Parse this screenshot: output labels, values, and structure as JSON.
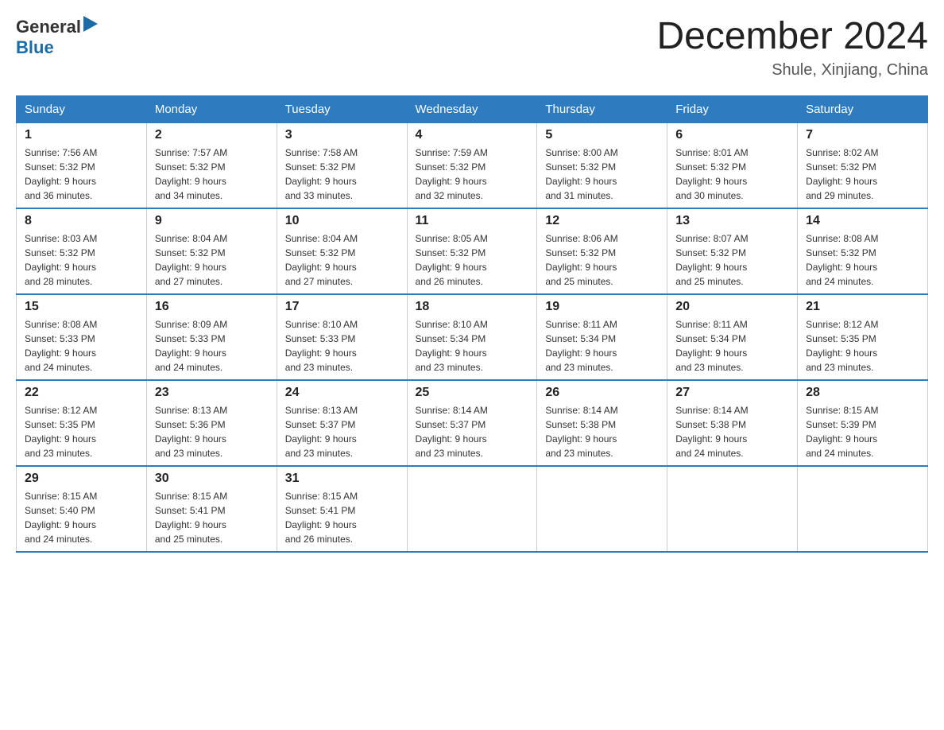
{
  "logo": {
    "general": "General",
    "blue": "Blue"
  },
  "title": "December 2024",
  "location": "Shule, Xinjiang, China",
  "weekdays": [
    "Sunday",
    "Monday",
    "Tuesday",
    "Wednesday",
    "Thursday",
    "Friday",
    "Saturday"
  ],
  "weeks": [
    [
      {
        "day": "1",
        "sunrise": "7:56 AM",
        "sunset": "5:32 PM",
        "daylight": "9 hours and 36 minutes."
      },
      {
        "day": "2",
        "sunrise": "7:57 AM",
        "sunset": "5:32 PM",
        "daylight": "9 hours and 34 minutes."
      },
      {
        "day": "3",
        "sunrise": "7:58 AM",
        "sunset": "5:32 PM",
        "daylight": "9 hours and 33 minutes."
      },
      {
        "day": "4",
        "sunrise": "7:59 AM",
        "sunset": "5:32 PM",
        "daylight": "9 hours and 32 minutes."
      },
      {
        "day": "5",
        "sunrise": "8:00 AM",
        "sunset": "5:32 PM",
        "daylight": "9 hours and 31 minutes."
      },
      {
        "day": "6",
        "sunrise": "8:01 AM",
        "sunset": "5:32 PM",
        "daylight": "9 hours and 30 minutes."
      },
      {
        "day": "7",
        "sunrise": "8:02 AM",
        "sunset": "5:32 PM",
        "daylight": "9 hours and 29 minutes."
      }
    ],
    [
      {
        "day": "8",
        "sunrise": "8:03 AM",
        "sunset": "5:32 PM",
        "daylight": "9 hours and 28 minutes."
      },
      {
        "day": "9",
        "sunrise": "8:04 AM",
        "sunset": "5:32 PM",
        "daylight": "9 hours and 27 minutes."
      },
      {
        "day": "10",
        "sunrise": "8:04 AM",
        "sunset": "5:32 PM",
        "daylight": "9 hours and 27 minutes."
      },
      {
        "day": "11",
        "sunrise": "8:05 AM",
        "sunset": "5:32 PM",
        "daylight": "9 hours and 26 minutes."
      },
      {
        "day": "12",
        "sunrise": "8:06 AM",
        "sunset": "5:32 PM",
        "daylight": "9 hours and 25 minutes."
      },
      {
        "day": "13",
        "sunrise": "8:07 AM",
        "sunset": "5:32 PM",
        "daylight": "9 hours and 25 minutes."
      },
      {
        "day": "14",
        "sunrise": "8:08 AM",
        "sunset": "5:32 PM",
        "daylight": "9 hours and 24 minutes."
      }
    ],
    [
      {
        "day": "15",
        "sunrise": "8:08 AM",
        "sunset": "5:33 PM",
        "daylight": "9 hours and 24 minutes."
      },
      {
        "day": "16",
        "sunrise": "8:09 AM",
        "sunset": "5:33 PM",
        "daylight": "9 hours and 24 minutes."
      },
      {
        "day": "17",
        "sunrise": "8:10 AM",
        "sunset": "5:33 PM",
        "daylight": "9 hours and 23 minutes."
      },
      {
        "day": "18",
        "sunrise": "8:10 AM",
        "sunset": "5:34 PM",
        "daylight": "9 hours and 23 minutes."
      },
      {
        "day": "19",
        "sunrise": "8:11 AM",
        "sunset": "5:34 PM",
        "daylight": "9 hours and 23 minutes."
      },
      {
        "day": "20",
        "sunrise": "8:11 AM",
        "sunset": "5:34 PM",
        "daylight": "9 hours and 23 minutes."
      },
      {
        "day": "21",
        "sunrise": "8:12 AM",
        "sunset": "5:35 PM",
        "daylight": "9 hours and 23 minutes."
      }
    ],
    [
      {
        "day": "22",
        "sunrise": "8:12 AM",
        "sunset": "5:35 PM",
        "daylight": "9 hours and 23 minutes."
      },
      {
        "day": "23",
        "sunrise": "8:13 AM",
        "sunset": "5:36 PM",
        "daylight": "9 hours and 23 minutes."
      },
      {
        "day": "24",
        "sunrise": "8:13 AM",
        "sunset": "5:37 PM",
        "daylight": "9 hours and 23 minutes."
      },
      {
        "day": "25",
        "sunrise": "8:14 AM",
        "sunset": "5:37 PM",
        "daylight": "9 hours and 23 minutes."
      },
      {
        "day": "26",
        "sunrise": "8:14 AM",
        "sunset": "5:38 PM",
        "daylight": "9 hours and 23 minutes."
      },
      {
        "day": "27",
        "sunrise": "8:14 AM",
        "sunset": "5:38 PM",
        "daylight": "9 hours and 24 minutes."
      },
      {
        "day": "28",
        "sunrise": "8:15 AM",
        "sunset": "5:39 PM",
        "daylight": "9 hours and 24 minutes."
      }
    ],
    [
      {
        "day": "29",
        "sunrise": "8:15 AM",
        "sunset": "5:40 PM",
        "daylight": "9 hours and 24 minutes."
      },
      {
        "day": "30",
        "sunrise": "8:15 AM",
        "sunset": "5:41 PM",
        "daylight": "9 hours and 25 minutes."
      },
      {
        "day": "31",
        "sunrise": "8:15 AM",
        "sunset": "5:41 PM",
        "daylight": "9 hours and 26 minutes."
      },
      null,
      null,
      null,
      null
    ]
  ],
  "labels": {
    "sunrise": "Sunrise:",
    "sunset": "Sunset:",
    "daylight": "Daylight:"
  }
}
